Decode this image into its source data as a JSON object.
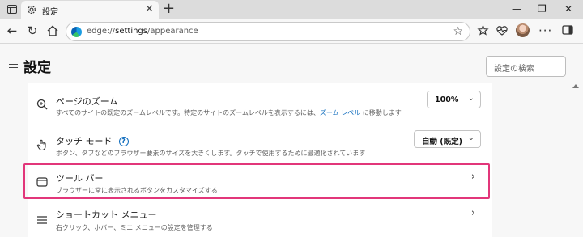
{
  "browser": {
    "tab": {
      "title": "設定",
      "close": "✕"
    },
    "new_tab": "+",
    "window_controls": {
      "minimize": "—",
      "maximize": "❐",
      "close": "✕"
    },
    "address": {
      "scheme": "edge://",
      "host": "settings",
      "path": "/appearance"
    }
  },
  "header": {
    "title": "設定",
    "search_placeholder": "設定の検索"
  },
  "settings": {
    "zoom": {
      "title": "ページのズーム",
      "desc_before": "すべてのサイトの既定のズームレベルです。特定のサイトのズームレベルを表示するには、",
      "desc_link": "ズーム レベル",
      "desc_after": " に移動します",
      "value": "100%"
    },
    "touch": {
      "title": "タッチ モード",
      "help": "?",
      "desc": "ボタン、タブなどのブラウザー要素のサイズを大きくします。タッチで使用するために最適化されています",
      "value": "自動 (既定)"
    },
    "toolbar": {
      "title": "ツール バー",
      "desc": "ブラウザーに常に表示されるボタンをカスタマイズする"
    },
    "shortcut_menu": {
      "title": "ショートカット メニュー",
      "desc": "右クリック、ホバー、ミニ メニューの設定を管理する"
    }
  },
  "colors": {
    "highlight": "#e2367a",
    "link": "#0f6cbd"
  }
}
